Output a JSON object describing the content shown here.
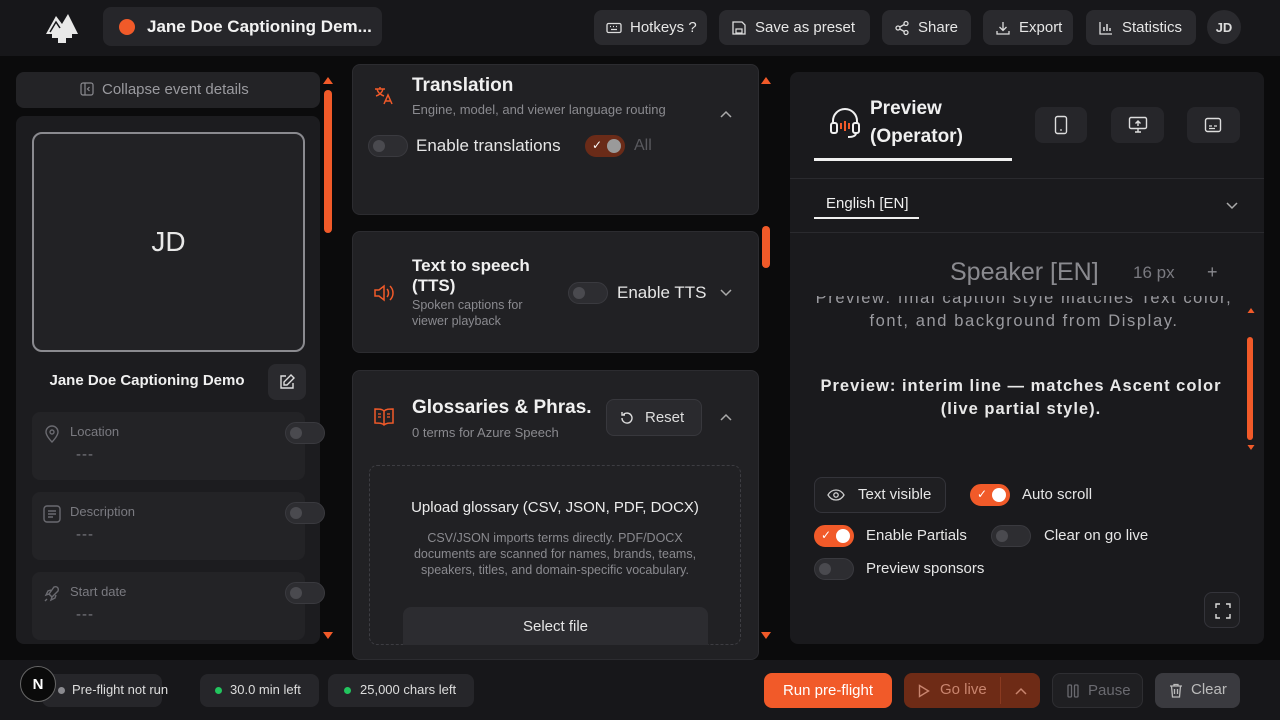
{
  "colors": {
    "accent": "#f15a29",
    "background": "#0b0b0c",
    "panel": "#1c1c1f",
    "success": "#22c55e"
  },
  "header": {
    "event_title": "Jane Doe Captioning Dem...",
    "buttons": {
      "hotkeys": "Hotkeys ?",
      "save_preset": "Save as preset",
      "share": "Share",
      "export": "Export",
      "statistics": "Statistics"
    },
    "avatar_initials": "JD"
  },
  "left_panel": {
    "collapse_label": "Collapse event details",
    "avatar_initials": "JD",
    "event_name": "Jane Doe Captioning Demo",
    "fields": [
      {
        "label": "Location",
        "value": "---",
        "icon": "location-pin-icon"
      },
      {
        "label": "Description",
        "value": "---",
        "icon": "document-icon"
      },
      {
        "label": "Start date",
        "value": "---",
        "icon": "rocket-icon"
      }
    ]
  },
  "middle_panel": {
    "translation": {
      "title": "Translation",
      "subtitle": "Engine, model, and viewer language routing",
      "enable_label": "Enable translations",
      "all_label": "All"
    },
    "tts": {
      "title": "Text to speech (TTS)",
      "subtitle": "Spoken captions for viewer playback",
      "enable_label": "Enable TTS"
    },
    "glossaries": {
      "title": "Glossaries & Phras...",
      "subtitle": "0 terms for Azure Speech",
      "reset_label": "Reset",
      "upload_title": "Upload glossary (CSV, JSON, PDF, DOCX)",
      "upload_desc": "CSV/JSON imports terms directly. PDF/DOCX documents are scanned for names, brands, teams, speakers, titles, and domain-specific vocabulary.",
      "select_file_label": "Select file"
    }
  },
  "preview_panel": {
    "title_line1": "Preview",
    "title_line2": "(Operator)",
    "language": "English [EN]",
    "speaker_label": "Speaker [EN]",
    "font_size": "16 px",
    "plus": "+",
    "final_text": "Preview: final caption style matches Text color, font, and background from Display.",
    "interim_text": "Preview: interim line — matches Ascent color (live partial style).",
    "text_visible_label": "Text visible",
    "auto_scroll_label": "Auto scroll",
    "enable_partials_label": "Enable Partials",
    "clear_on_go_live_label": "Clear on go live",
    "preview_sponsors_label": "Preview sponsors",
    "toggles": {
      "auto_scroll": true,
      "enable_partials": true,
      "clear_on_go_live": false,
      "preview_sponsors": false
    }
  },
  "footer": {
    "n_badge": "N",
    "preflight_status": "Pre-flight not run",
    "minutes_left": "30.0 min left",
    "chars_left": "25,000 chars left",
    "run_preflight_label": "Run pre-flight",
    "go_live_label": "Go live",
    "pause_label": "Pause",
    "clear_label": "Clear"
  }
}
